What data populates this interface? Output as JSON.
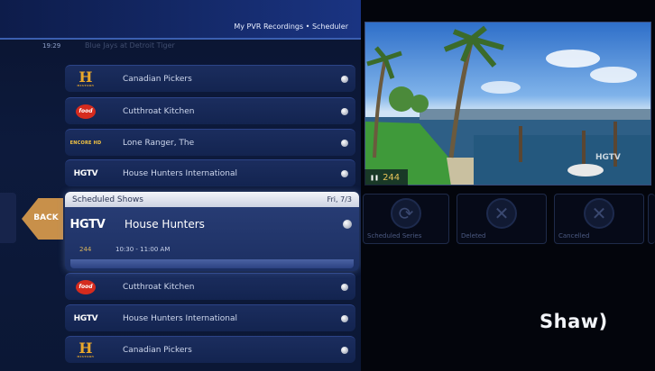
{
  "header": {
    "title": "My PVR Recordings • Scheduler"
  },
  "time": "19:29",
  "faded_row": {
    "title": "Blue Jays at Detroit Tiger"
  },
  "upper_rows": [
    {
      "logo": "H",
      "logo_sub": "HISTORY",
      "title": "Canadian Pickers"
    },
    {
      "logo": "food",
      "title": "Cutthroat Kitchen"
    },
    {
      "logo": "ENCORE HD",
      "title": "Lone Ranger, The"
    },
    {
      "logo": "HGTV",
      "title": "House Hunters International"
    }
  ],
  "scheduled": {
    "heading": "Scheduled Shows",
    "date": "Fri, 7/3",
    "logo": "HGTV",
    "title": "House Hunters",
    "channel": "244",
    "time": "10:30 - 11:00 AM"
  },
  "lower_rows": [
    {
      "logo": "food",
      "title": "Cutthroat Kitchen"
    },
    {
      "logo": "HGTV",
      "title": "House Hunters International"
    },
    {
      "logo": "H",
      "logo_sub": "HISTORY",
      "title": "Canadian Pickers"
    }
  ],
  "back_label": "BACK",
  "video": {
    "channel": "244",
    "bug": "HGTV"
  },
  "options": [
    {
      "label": "Scheduled Series"
    },
    {
      "label": "Deleted"
    },
    {
      "label": "Cancelled"
    }
  ],
  "brand": "Shaw)"
}
